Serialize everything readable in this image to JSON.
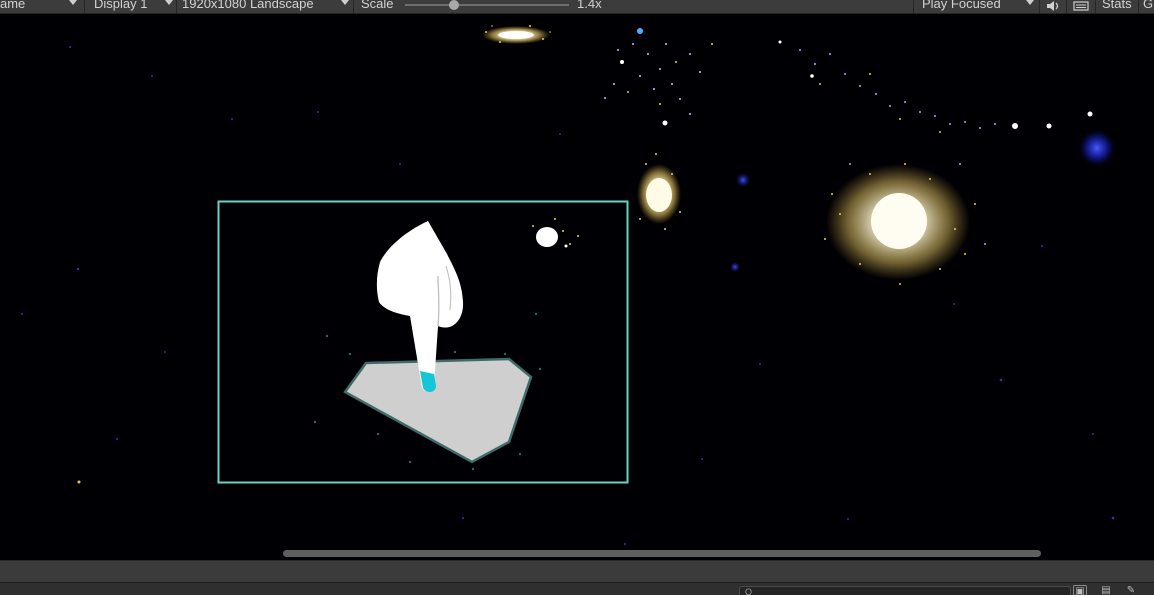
{
  "toolbar": {
    "view_label": "ame",
    "display_label": "Display 1",
    "resolution_label": "1920x1080 Landscape",
    "scale_label": "Scale",
    "scale_value": "1.4x",
    "scale_fraction": 0.3,
    "play_mode_label": "Play Focused",
    "stats_label": "Stats",
    "gizmos_label": "G"
  },
  "game_view": {
    "background_color": "#000004",
    "highlight_frame_color": "#63d6c3",
    "shape_fill_color": "#cfcfcf",
    "fingertip_color": "#14c6d6",
    "hint_icon": "pointing-hand-icon"
  },
  "status_bar": {
    "search_placeholder": "Q",
    "icons": [
      "panel-toggle-icon",
      "layers-icon",
      "pin-icon"
    ]
  },
  "colors": {
    "toolbar_bg": "#3c3c3c",
    "scrollbar": "#5f5f5f"
  }
}
